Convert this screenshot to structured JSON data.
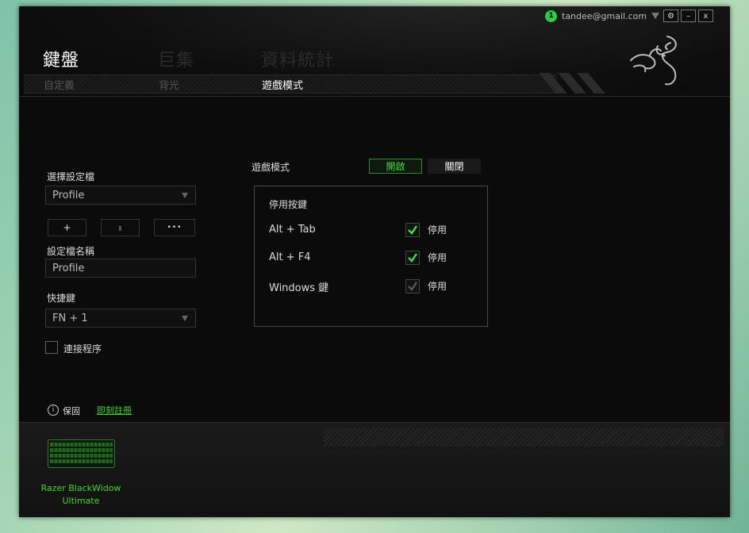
{
  "user": {
    "notifications": "1",
    "email": "tandee@gmail.com"
  },
  "window_buttons": {
    "settings": "⚙",
    "minimize": "–",
    "close": "x"
  },
  "tabs": {
    "main": [
      "鍵盤",
      "巨集",
      "資料統計"
    ],
    "sub": [
      "自定義",
      "背光",
      "遊戲模式"
    ]
  },
  "sidebar": {
    "profile_label": "選擇設定檔",
    "profile_value": "Profile",
    "add_button": "+",
    "delete_button": "▮",
    "more_button": "•••",
    "profile_name_label": "設定檔名稱",
    "profile_name_value": "Profile",
    "shortcut_label": "快捷鍵",
    "shortcut_value": "FN + 1",
    "link_program_label": "連接程序"
  },
  "gamemode": {
    "label": "遊戲模式",
    "on": "開啟",
    "off": "關閉",
    "box_title": "停用按鍵",
    "rows": [
      {
        "key": "Alt + Tab",
        "label": "停用"
      },
      {
        "key": "Alt + F4",
        "label": "停用"
      },
      {
        "key": "Windows 鍵",
        "label": "停用"
      }
    ]
  },
  "footer": {
    "warranty": "保固",
    "register": "即刻註冊"
  },
  "device": {
    "name_line1": "Razer BlackWidow",
    "name_line2": "Ultimate"
  },
  "colors": {
    "accent": "#44d62c",
    "background": "#0b0b0b"
  }
}
